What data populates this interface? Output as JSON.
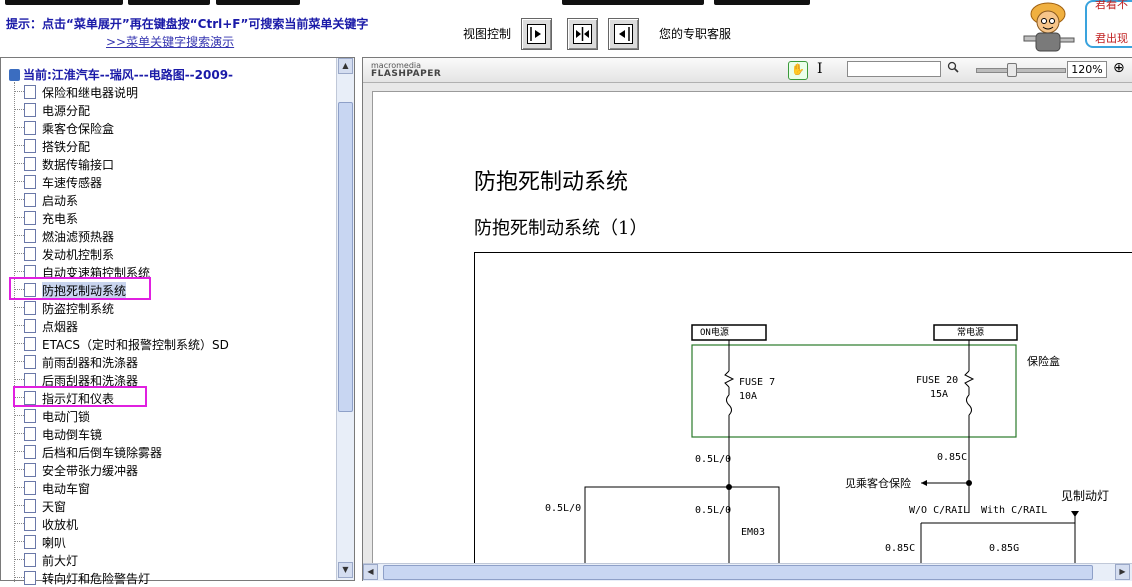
{
  "topbar": {
    "hint": "提示：点击“菜单展开”再在键盘按“Ctrl+F”可搜索当前菜单关键字",
    "demo_link": ">>菜单关键字搜索演示",
    "view_label": "视图控制",
    "service_label": "您的专职客服",
    "bubble_line1": "君看不",
    "bubble_line2": "君出现"
  },
  "tree": {
    "root": "当前:江淮汽车--瑞风---电路图--2009-",
    "items": [
      "保险和继电器说明",
      "电源分配",
      "乘客仓保险盒",
      "搭铁分配",
      "数据传输接口",
      "车速传感器",
      "启动系",
      "充电系",
      "燃油滤预热器",
      "发动机控制系",
      "自动变速箱控制系统",
      "防抱死制动系统",
      "防盗控制系统",
      "点烟器",
      "ETACS（定时和报警控制系统）SD",
      "前雨刮器和洗涤器",
      "后雨刮器和洗涤器",
      "指示灯和仪表",
      "电动门锁",
      "电动倒车镜",
      "后档和后倒车镜除雾器",
      "安全带张力缓冲器",
      "电动车窗",
      "天窗",
      "收放机",
      "喇叭",
      "前大灯",
      "转向灯和危险警告灯"
    ],
    "selected_index": 11,
    "highlighted_indices": [
      11,
      17
    ]
  },
  "viewer": {
    "logo_small": "macromedia",
    "logo_big": "FLASHPAPER",
    "zoom": "120%",
    "doc_title": "防抱死制动系统",
    "doc_subtitle": "防抱死制动系统（1）",
    "diagram": {
      "box_left": "ON电源",
      "box_right": "常电源",
      "fuse_box_label": "保险盒",
      "fuse_left": "FUSE 7",
      "fuse_left_amp": "10A",
      "fuse_right": "FUSE 20",
      "fuse_right_amp": "15A",
      "wire_left": "0.5L/0",
      "wire_right": "0.85C",
      "see_fuse": "见乘客仓保险",
      "wire_left2": "0.5L/0",
      "wire_far_left": "0.5L/0",
      "connector": "EM03",
      "rail_wo": "W/O C/RAIL",
      "rail_with": "With C/RAIL",
      "see_brake_lamp": "见制动灯",
      "wire_b1": "0.85C",
      "wire_b2": "0.85G"
    }
  }
}
